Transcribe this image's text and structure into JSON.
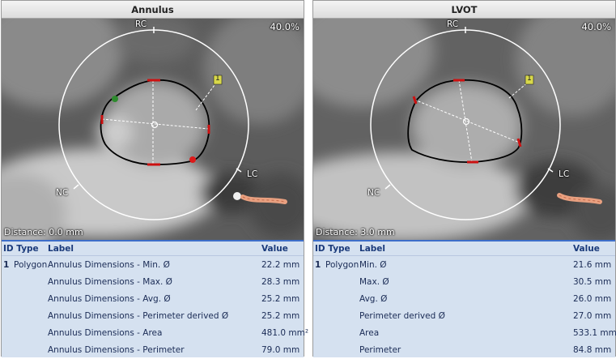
{
  "zoom": "40.0%",
  "orientation": {
    "rc": "RC",
    "nc": "NC",
    "lc": "LC",
    "marker": "1"
  },
  "columns": {
    "id_type": "ID Type",
    "label": "Label",
    "value": "Value"
  },
  "annulus": {
    "title": "Annulus",
    "distance": "Distance: 0.0 mm",
    "rows": [
      {
        "id": "1",
        "type": "Polygon",
        "label": "Annulus Dimensions - Min. Ø",
        "value": "22.2 mm"
      },
      {
        "id": "",
        "type": "",
        "label": "Annulus Dimensions - Max. Ø",
        "value": "28.3 mm"
      },
      {
        "id": "",
        "type": "",
        "label": "Annulus Dimensions - Avg. Ø",
        "value": "25.2 mm"
      },
      {
        "id": "",
        "type": "",
        "label": "Annulus Dimensions - Perimeter derived Ø",
        "value": "25.2 mm"
      },
      {
        "id": "",
        "type": "",
        "label": "Annulus Dimensions - Area",
        "value": "481.0 mm²"
      },
      {
        "id": "",
        "type": "",
        "label": "Annulus Dimensions - Perimeter",
        "value": "79.0 mm"
      }
    ]
  },
  "lvot": {
    "title": "LVOT",
    "distance": "Distance: 3.0 mm",
    "rows": [
      {
        "id": "1",
        "type": "Polygon",
        "label": "Min. Ø",
        "value": "21.6 mm"
      },
      {
        "id": "",
        "type": "",
        "label": "Max. Ø",
        "value": "30.5 mm"
      },
      {
        "id": "",
        "type": "",
        "label": "Avg. Ø",
        "value": "26.0 mm"
      },
      {
        "id": "",
        "type": "",
        "label": "Perimeter derived Ø",
        "value": "27.0 mm"
      },
      {
        "id": "",
        "type": "",
        "label": "Area",
        "value": "533.1 mm²"
      },
      {
        "id": "",
        "type": "",
        "label": "Perimeter",
        "value": "84.8 mm"
      }
    ]
  }
}
